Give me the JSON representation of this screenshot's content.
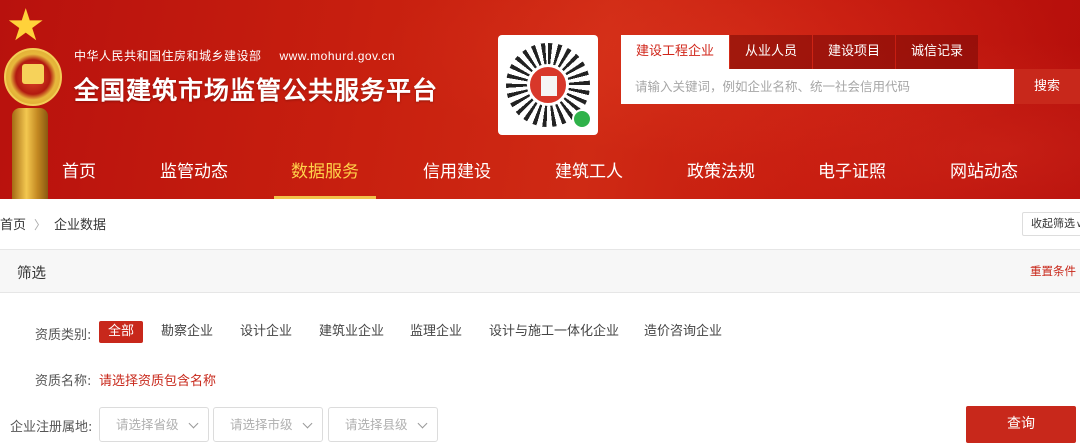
{
  "header": {
    "ministry_name": "中华人民共和国住房和城乡建设部",
    "ministry_url": "www.mohurd.gov.cn",
    "site_title": "全国建筑市场监管公共服务平台",
    "brand_color": "#c8281b"
  },
  "search": {
    "tabs": [
      {
        "label": "建设工程企业",
        "active": true
      },
      {
        "label": "从业人员",
        "active": false
      },
      {
        "label": "建设项目",
        "active": false
      },
      {
        "label": "诚信记录",
        "active": false
      }
    ],
    "placeholder": "请输入关键词，例如企业名称、统一社会信用代码",
    "button_label": "搜索"
  },
  "nav": {
    "items": [
      {
        "label": "首页",
        "active": false
      },
      {
        "label": "监管动态",
        "active": false
      },
      {
        "label": "数据服务",
        "active": true
      },
      {
        "label": "信用建设",
        "active": false
      },
      {
        "label": "建筑工人",
        "active": false
      },
      {
        "label": "政策法规",
        "active": false
      },
      {
        "label": "电子证照",
        "active": false
      },
      {
        "label": "网站动态",
        "active": false
      }
    ]
  },
  "breadcrumb": {
    "items": [
      "首页",
      "企业数据"
    ],
    "collapse_label": "收起筛选"
  },
  "filter": {
    "title": "筛选",
    "reset_label": "重置条件",
    "type_label": "资质类别:",
    "type_options": [
      {
        "label": "全部",
        "active": true
      },
      {
        "label": "勘察企业",
        "active": false
      },
      {
        "label": "设计企业",
        "active": false
      },
      {
        "label": "建筑业企业",
        "active": false
      },
      {
        "label": "监理企业",
        "active": false
      },
      {
        "label": "设计与施工一体化企业",
        "active": false
      },
      {
        "label": "造价咨询企业",
        "active": false
      }
    ],
    "name_label": "资质名称:",
    "name_link": "请选择资质包含名称",
    "region_label": "企业注册属地:",
    "province_placeholder": "请选择省级",
    "city_placeholder": "请选择市级",
    "county_placeholder": "请选择县级",
    "query_label": "查询"
  }
}
